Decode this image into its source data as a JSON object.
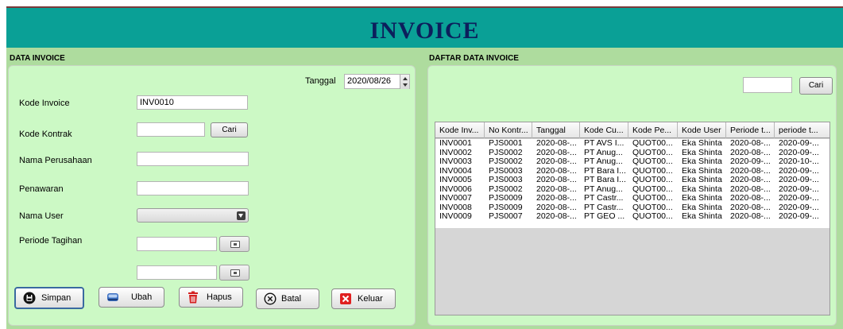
{
  "header": {
    "title": "INVOICE"
  },
  "left_panel": {
    "title": "DATA INVOICE",
    "tanggal_label": "Tanggal",
    "tanggal_value": "2020/08/26",
    "kode_invoice_label": "Kode Invoice",
    "kode_invoice_value": "INV0010",
    "kode_kontrak_label": "Kode Kontrak",
    "kode_kontrak_value": "",
    "cari_label": "Cari",
    "nama_perusahaan_label": "Nama Perusahaan",
    "nama_perusahaan_value": "",
    "penawaran_label": "Penawaran",
    "penawaran_value": "",
    "nama_user_label": "Nama User",
    "nama_user_value": "",
    "periode_tagihan_label": "Periode Tagihan",
    "periode_start_value": "",
    "periode_end_value": ""
  },
  "actions": {
    "simpan": "Simpan",
    "ubah": "Ubah",
    "hapus": "Hapus",
    "batal": "Batal",
    "keluar": "Keluar"
  },
  "right_panel": {
    "title": "DAFTAR DATA INVOICE",
    "search_value": "",
    "cari_label": "Cari",
    "columns": [
      "Kode Inv...",
      "No Kontr...",
      "Tanggal",
      "Kode Cu...",
      "Kode Pe...",
      "Kode User",
      "Periode t...",
      "periode t..."
    ],
    "rows": [
      [
        "INV0001",
        "PJS0001",
        "2020-08-...",
        "PT AVS I...",
        "QUOT00...",
        "Eka Shinta",
        "2020-08-...",
        "2020-09-..."
      ],
      [
        "INV0002",
        "PJS0002",
        "2020-08-...",
        "PT Anug...",
        "QUOT00...",
        "Eka Shinta",
        "2020-08-...",
        "2020-09-..."
      ],
      [
        "INV0003",
        "PJS0002",
        "2020-08-...",
        "PT Anug...",
        "QUOT00...",
        "Eka Shinta",
        "2020-09-...",
        "2020-10-..."
      ],
      [
        "INV0004",
        "PJS0003",
        "2020-08-...",
        "PT Bara I...",
        "QUOT00...",
        "Eka Shinta",
        "2020-08-...",
        "2020-09-..."
      ],
      [
        "INV0005",
        "PJS0003",
        "2020-08-...",
        "PT Bara I...",
        "QUOT00...",
        "Eka Shinta",
        "2020-08-...",
        "2020-09-..."
      ],
      [
        "INV0006",
        "PJS0002",
        "2020-08-...",
        "PT Anug...",
        "QUOT00...",
        "Eka Shinta",
        "2020-08-...",
        "2020-09-..."
      ],
      [
        "INV0007",
        "PJS0009",
        "2020-08-...",
        "PT Castr...",
        "QUOT00...",
        "Eka Shinta",
        "2020-08-...",
        "2020-09-..."
      ],
      [
        "INV0008",
        "PJS0009",
        "2020-08-...",
        "PT Castr...",
        "QUOT00...",
        "Eka Shinta",
        "2020-08-...",
        "2020-09-..."
      ],
      [
        "INV0009",
        "PJS0007",
        "2020-08-...",
        "PT GEO ...",
        "QUOT00...",
        "Eka Shinta",
        "2020-08-...",
        "2020-09-..."
      ]
    ]
  },
  "colors": {
    "header_bg": "#0aa096",
    "header_title": "#0c1f5c",
    "main_bg": "#aedc9e",
    "panel_bg": "#ccf9c5",
    "hapus_icon": "#d42020",
    "keluar_icon": "#e02020"
  },
  "icons": {
    "simpan": "save-disk-icon",
    "ubah": "edit-drive-icon",
    "hapus": "trash-icon",
    "batal": "cancel-circle-icon",
    "keluar": "exit-x-icon",
    "date_picker": "calendar-icon"
  }
}
